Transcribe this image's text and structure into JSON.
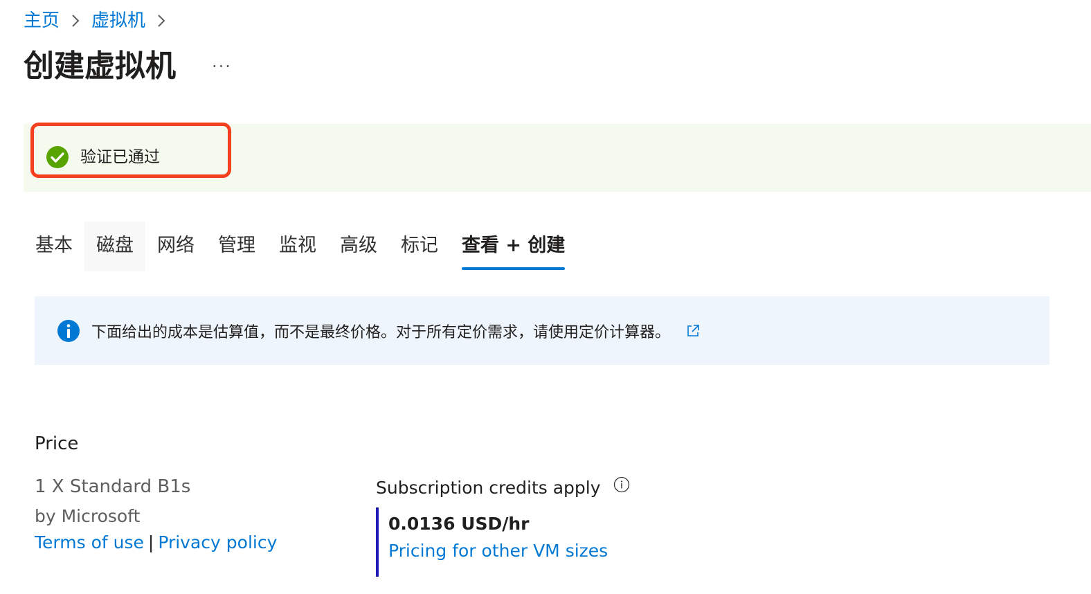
{
  "breadcrumb": {
    "items": [
      "主页",
      "虚拟机"
    ]
  },
  "header": {
    "title": "创建虚拟机",
    "more_label": "···"
  },
  "validation": {
    "text": "验证已通过",
    "status_color": "#57a300",
    "highlight_color": "#f5401f"
  },
  "tabs": {
    "items": [
      {
        "label": "基本"
      },
      {
        "label": "磁盘"
      },
      {
        "label": "网络"
      },
      {
        "label": "管理"
      },
      {
        "label": "监视"
      },
      {
        "label": "高级"
      },
      {
        "label": "标记"
      },
      {
        "label": "查看 + 创建"
      }
    ],
    "active_index": 7
  },
  "info_bar": {
    "text": "下面给出的成本是估算值，而不是最终价格。对于所有定价需求，请使用定价计算器。",
    "icon": "info-icon",
    "link_icon": "external-link-icon"
  },
  "price": {
    "heading": "Price",
    "sku": "1 X Standard B1s",
    "publisher": "by Microsoft",
    "terms_label": "Terms of use",
    "separator": "|",
    "privacy_label": "Privacy policy",
    "subscription_label": "Subscription credits apply",
    "rate": "0.0136 USD/hr",
    "other_sizes_label": "Pricing for other VM sizes"
  },
  "colors": {
    "accent": "#0078d4",
    "info_bg": "#eff5fc",
    "success_bg": "#f5faee"
  }
}
